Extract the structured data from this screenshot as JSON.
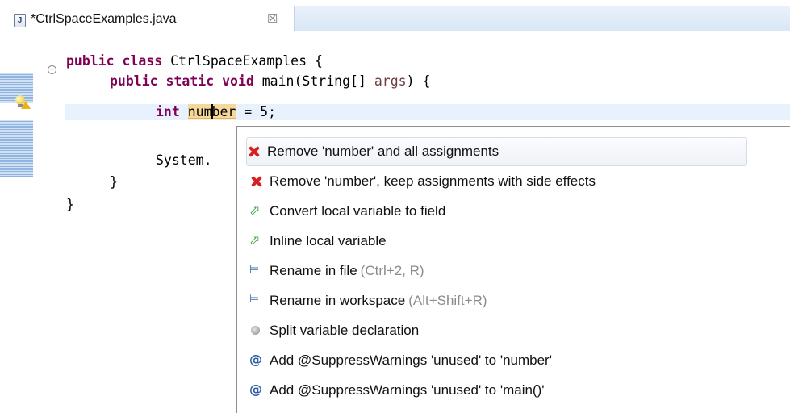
{
  "tab": {
    "icon_letter": "J",
    "title": "*CtrlSpaceExamples.java",
    "close_glyph": "☒"
  },
  "editor": {
    "fold_glyph": "−",
    "lines": {
      "l1_kw": "public class",
      "l1_rest": " CtrlSpaceExamples {",
      "l2_kw": "public static void",
      "l2_mid": " main(String[] ",
      "l2_param": "args",
      "l2_end": ") {",
      "l3_kw": "int",
      "l3_occ_a": "num",
      "l3_occ_b": "ber",
      "l3_end": " = 5;",
      "l4_text": "System.",
      "l5_text": "}",
      "l6_text": "}"
    }
  },
  "popup": {
    "items": [
      {
        "icon": "delete-icon",
        "label": "Remove 'number' and all assignments",
        "hint": ""
      },
      {
        "icon": "delete-icon",
        "label": "Remove 'number', keep assignments with side effects",
        "hint": ""
      },
      {
        "icon": "change-arrow-icon",
        "label": "Convert local variable to field",
        "hint": ""
      },
      {
        "icon": "change-arrow-icon",
        "label": "Inline local variable",
        "hint": ""
      },
      {
        "icon": "rename-icon",
        "label": "Rename in file",
        "hint": "(Ctrl+2, R)"
      },
      {
        "icon": "rename-icon",
        "label": "Rename in workspace",
        "hint": "(Alt+Shift+R)"
      },
      {
        "icon": "split-icon",
        "label": "Split variable declaration",
        "hint": ""
      },
      {
        "icon": "annotation-icon",
        "label": "Add @SuppressWarnings 'unused' to 'number'",
        "hint": ""
      },
      {
        "icon": "annotation-icon",
        "label": "Add @SuppressWarnings 'unused' to 'main()'",
        "hint": ""
      }
    ],
    "glyphs": {
      "arrow": "⬀",
      "rename": "⊨",
      "at": "@"
    }
  },
  "colors": {
    "keyword": "#7f0055",
    "parameter": "#6a3e3e",
    "current_line": "#e8f2fe",
    "occurrence": "#f6d89b"
  }
}
